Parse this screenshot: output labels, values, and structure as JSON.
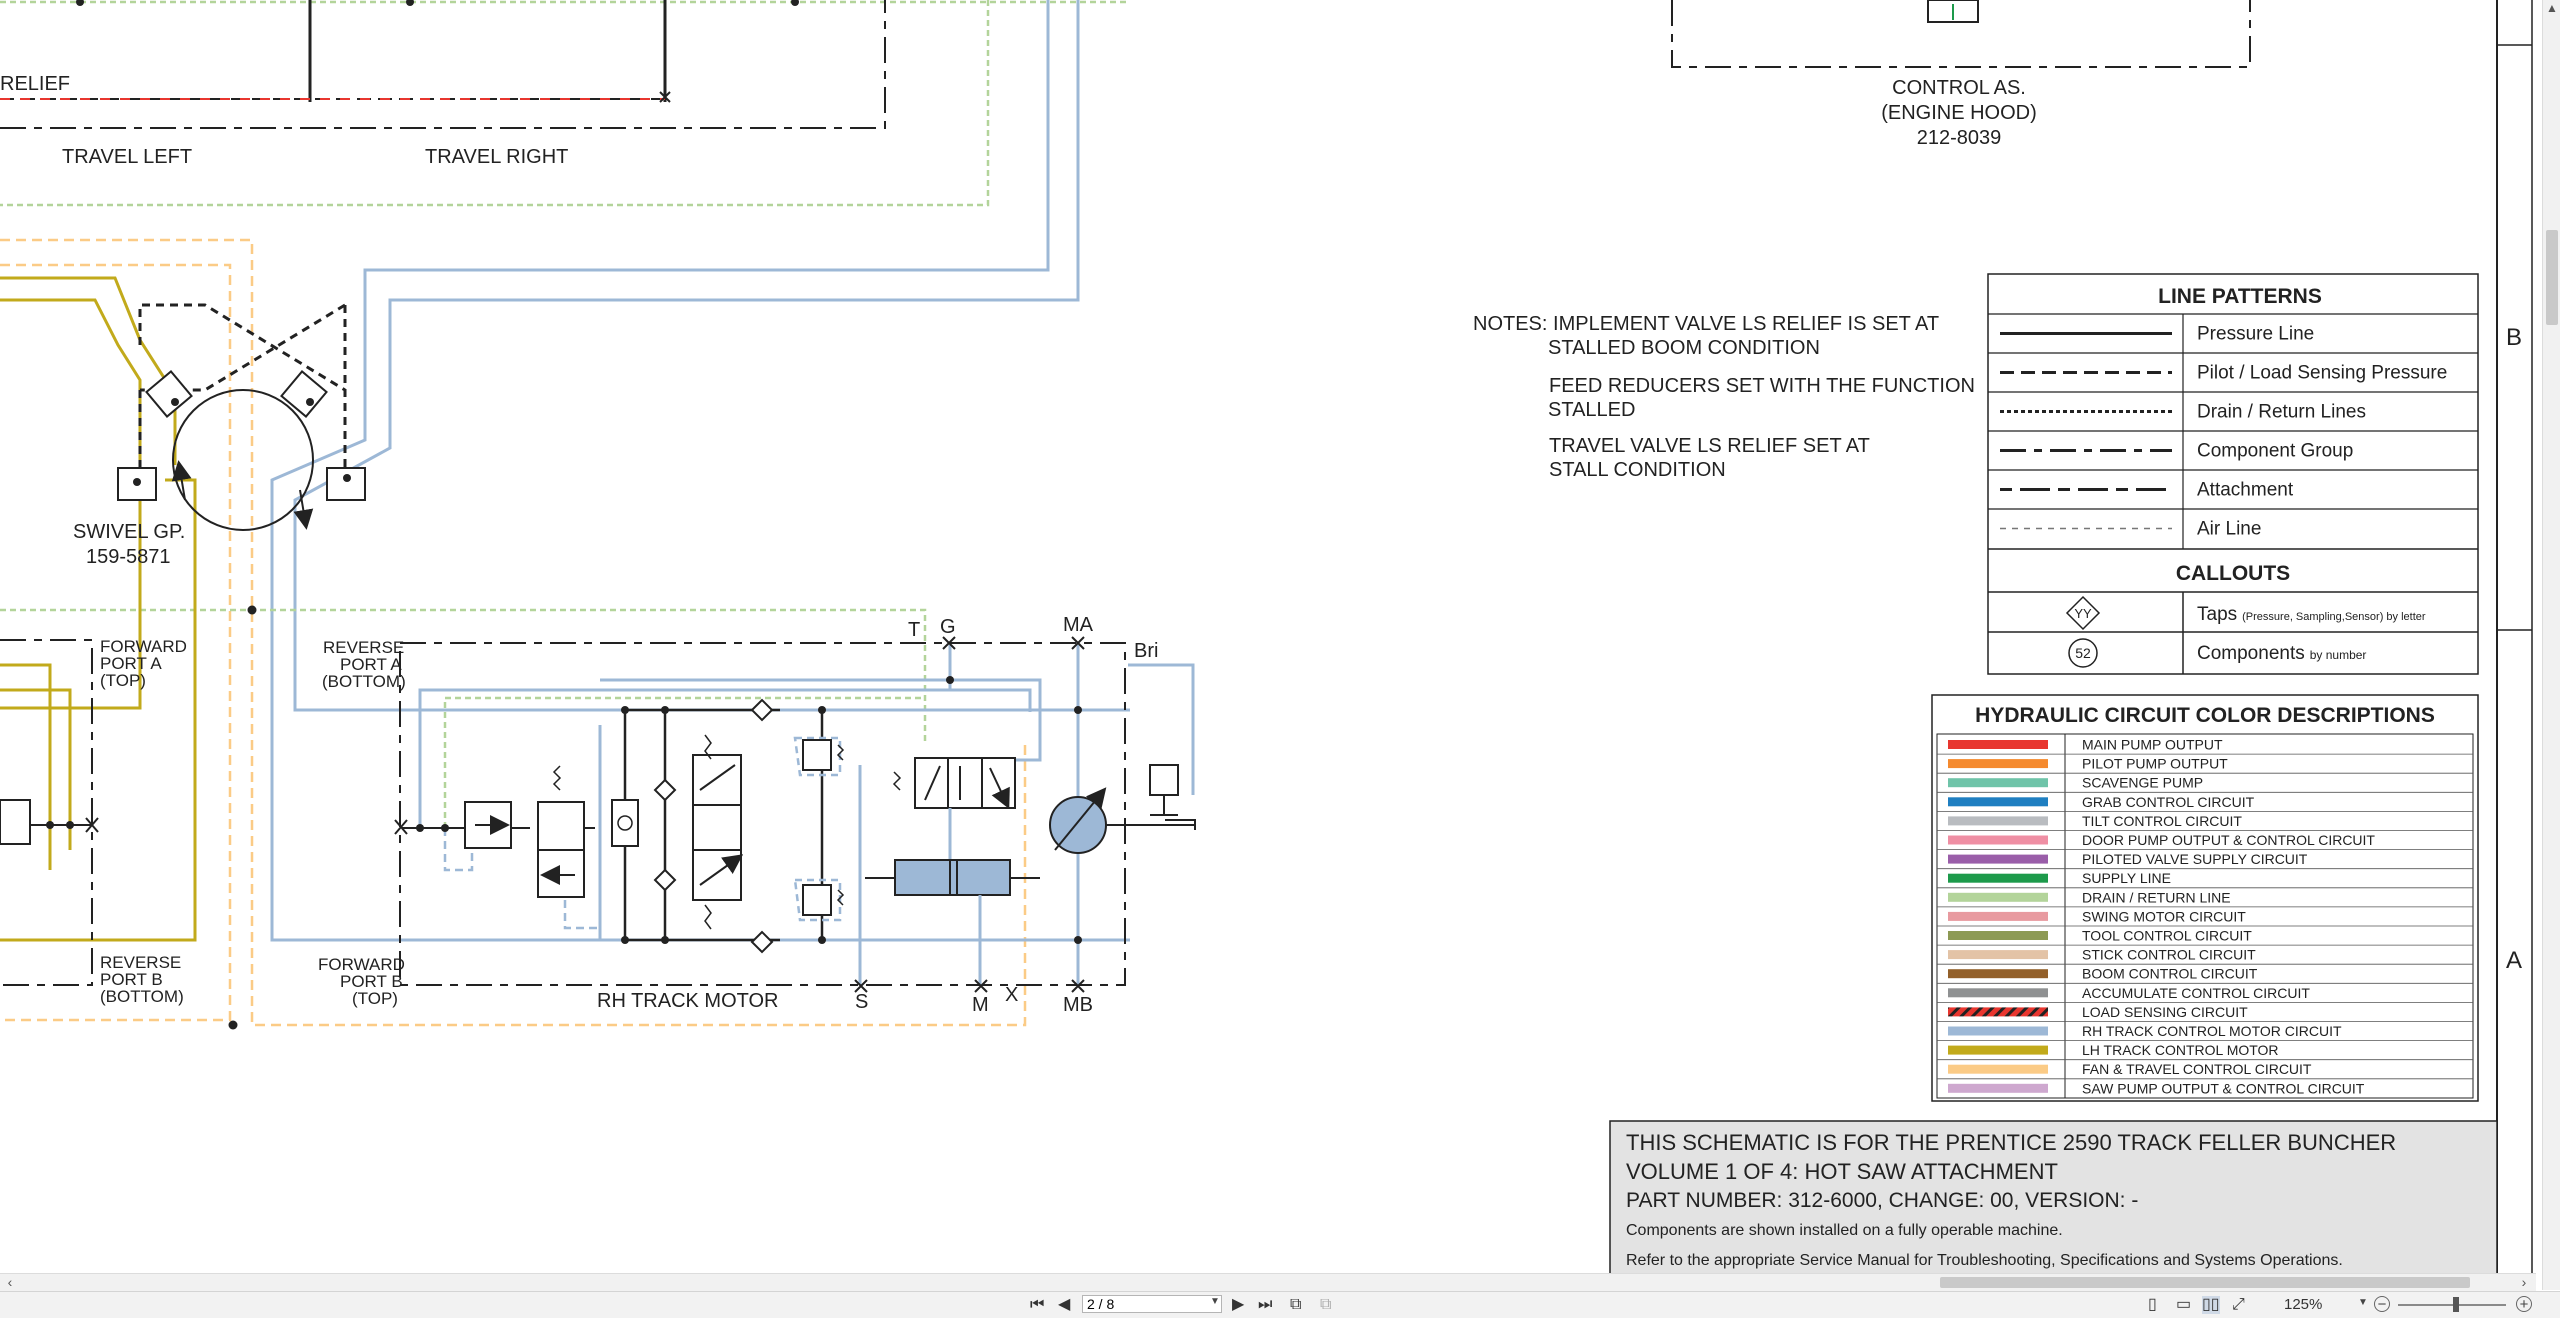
{
  "schematic": {
    "labels": {
      "relief": "RELIEF",
      "travel_left": "TRAVEL LEFT",
      "travel_right": "TRAVEL RIGHT",
      "swivel_line1": "SWIVEL GP.",
      "swivel_line2": "159-5871",
      "forward_port_a_1": "FORWARD",
      "forward_port_a_2": "PORT A",
      "forward_port_a_3": "(TOP)",
      "reverse_port_b_1": "REVERSE",
      "reverse_port_b_2": "PORT B",
      "reverse_port_b_3": "(BOTTOM)",
      "reverse_port_a_1": "REVERSE",
      "reverse_port_a_2": "PORT A",
      "reverse_port_a_3": "(BOTTOM)",
      "forward_port_b_1": "FORWARD",
      "forward_port_b_2": "PORT B",
      "forward_port_b_3": "(TOP)",
      "rh_track_motor": "RH TRACK MOTOR",
      "port_t": "T",
      "port_g": "G",
      "port_ma": "MA",
      "port_bri": "Bri",
      "port_s": "S",
      "port_m": "M",
      "port_x": "X",
      "port_mb": "MB",
      "control_line1": "CONTROL AS.",
      "control_line2": "(ENGINE HOOD)",
      "control_line3": "212-8039"
    },
    "notes": {
      "line1": "NOTES: IMPLEMENT VALVE LS RELIEF IS SET AT",
      "line2": "STALLED BOOM CONDITION",
      "line3": "FEED REDUCERS SET WITH THE FUNCTION",
      "line4": "STALLED",
      "line5": "TRAVEL VALVE LS RELIEF SET AT",
      "line6": "STALL CONDITION"
    },
    "zones": {
      "b": "B",
      "a": "A"
    }
  },
  "line_patterns": {
    "title": "LINE PATTERNS",
    "items": [
      {
        "label": "Pressure Line",
        "dash": ""
      },
      {
        "label": "Pilot / Load Sensing Pressure",
        "dash": "14 7"
      },
      {
        "label": "Drain / Return Lines",
        "dash": "4 3"
      },
      {
        "label": "Component Group",
        "dash": "26 8 8 8"
      },
      {
        "label": "Attachment",
        "dash": "12 8 30 8"
      },
      {
        "label": "Air Line",
        "dash": "6 6"
      }
    ],
    "callouts_title": "CALLOUTS",
    "taps_symbol": "YY",
    "taps_label": "Taps",
    "taps_note": "(Pressure, Sampling,Sensor) by letter",
    "components_symbol": "52",
    "components_label": "Components",
    "components_note": "by number"
  },
  "color_descriptions": {
    "title": "HYDRAULIC CIRCUIT COLOR DESCRIPTIONS",
    "items": [
      {
        "label": "MAIN PUMP OUTPUT",
        "color": "#e8362f"
      },
      {
        "label": "PILOT PUMP OUTPUT",
        "color": "#f58a2e"
      },
      {
        "label": "SCAVENGE PUMP",
        "color": "#6fc4a9"
      },
      {
        "label": "GRAB CONTROL CIRCUIT",
        "color": "#1f7fc1"
      },
      {
        "label": "TILT CONTROL CIRCUIT",
        "color": "#b9bcc0"
      },
      {
        "label": "DOOR PUMP OUTPUT & CONTROL CIRCUIT",
        "color": "#ef8fa4"
      },
      {
        "label": "PILOTED VALVE SUPPLY CIRCUIT",
        "color": "#9a5ea9"
      },
      {
        "label": "SUPPLY LINE",
        "color": "#1d9a4b"
      },
      {
        "label": "DRAIN / RETURN LINE",
        "color": "#b3d49a"
      },
      {
        "label": "SWING MOTOR CIRCUIT",
        "color": "#e89aa0"
      },
      {
        "label": "TOOL CONTROL CIRCUIT",
        "color": "#8d9a54"
      },
      {
        "label": "STICK CONTROL CIRCUIT",
        "color": "#e3c3a6"
      },
      {
        "label": "BOOM CONTROL CIRCUIT",
        "color": "#93602a"
      },
      {
        "label": "ACCUMULATE CONTROL CIRCUIT",
        "color": "#8f9192"
      },
      {
        "label": "LOAD SENSING CIRCUIT",
        "color": "#e8362f",
        "hatched": true
      },
      {
        "label": "RH TRACK CONTROL MOTOR CIRCUIT",
        "color": "#9db8d6"
      },
      {
        "label": "LH TRACK CONTROL MOTOR",
        "color": "#c2aa1b"
      },
      {
        "label": "FAN & TRAVEL CONTROL CIRCUIT",
        "color": "#fbcb86"
      },
      {
        "label": "SAW PUMP OUTPUT & CONTROL CIRCUIT",
        "color": "#cea8cf"
      }
    ]
  },
  "info_box": {
    "line1": "THIS SCHEMATIC IS FOR THE PRENTICE 2590 TRACK FELLER BUNCHER",
    "line2": "VOLUME 1 OF 4: HOT SAW ATTACHMENT",
    "line3": "PART NUMBER: 312-6000, CHANGE: 00, VERSION: -",
    "line4": "Components are shown installed on a fully operable machine.",
    "line5": "Refer to the appropriate Service Manual for Troubleshooting, Specifications and Systems Operations."
  },
  "statusbar": {
    "page_value": "2 / 8",
    "zoom": "125%"
  },
  "colors": {
    "rh_track": "#9db8d6",
    "lh_track": "#c2aa1b",
    "drain": "#b3d49a",
    "fan": "#fbcb86",
    "load_sensing": "#e8362f",
    "box_bg": "#e3e3e3"
  }
}
